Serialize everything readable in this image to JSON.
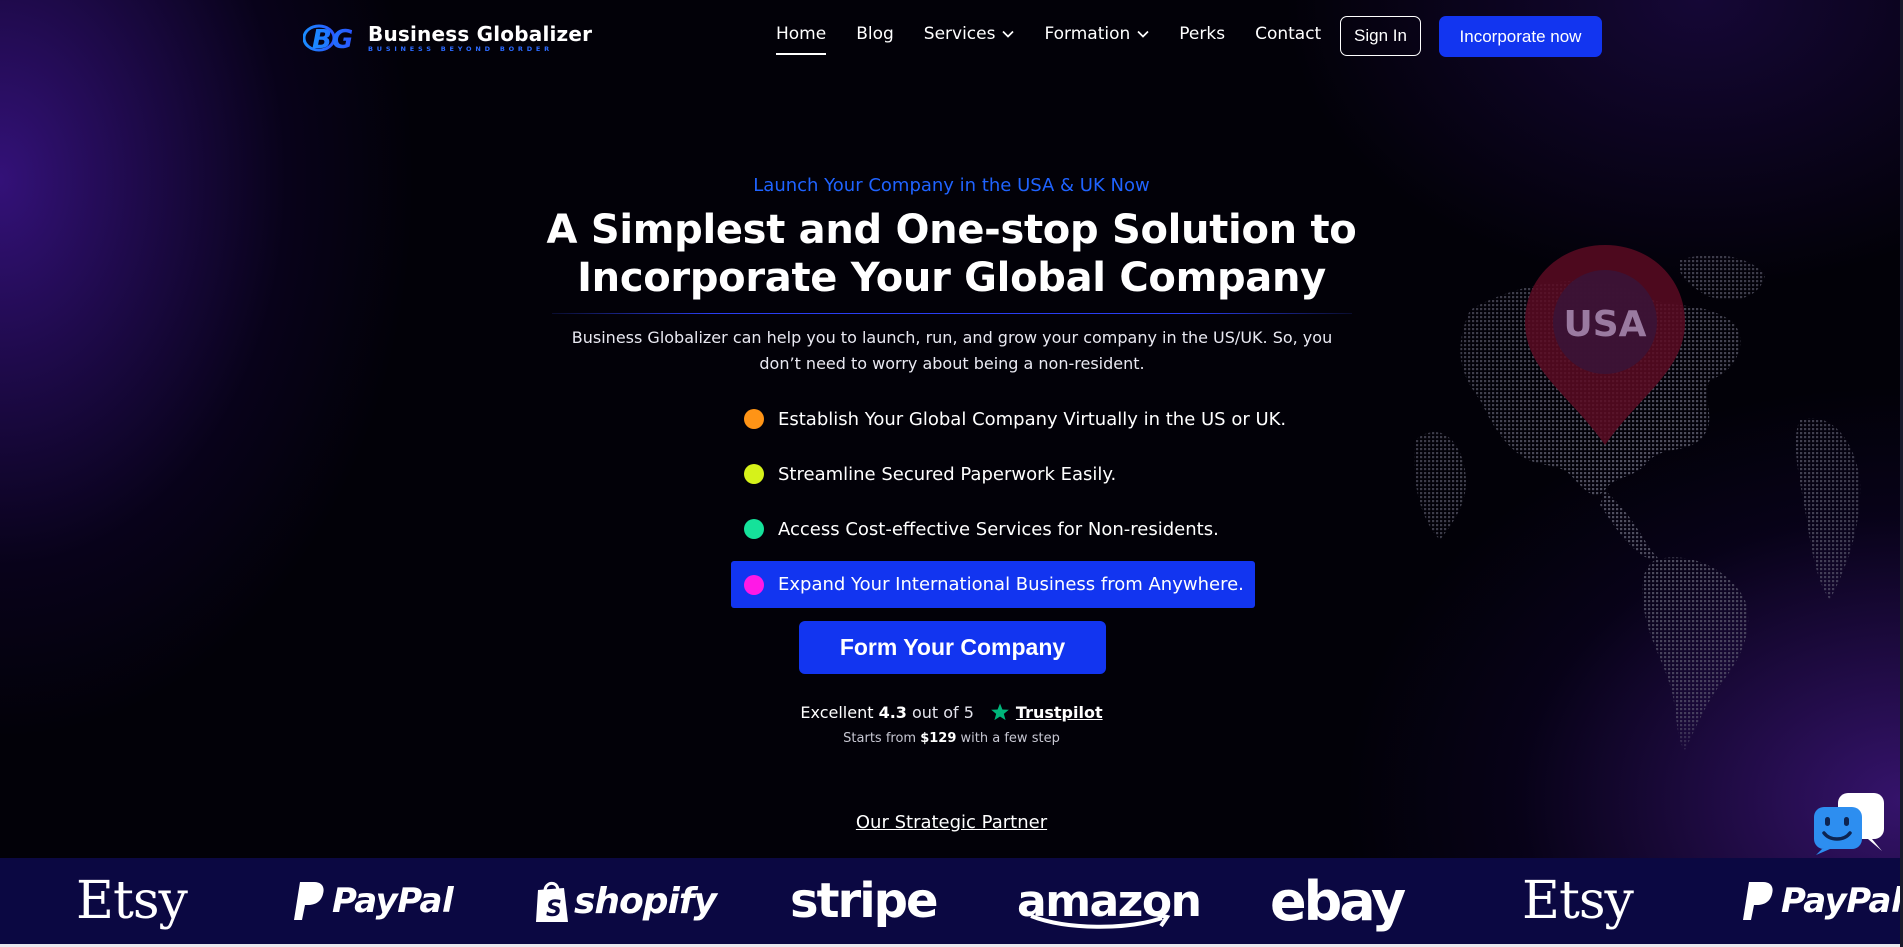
{
  "colors": {
    "accent": "#1235f0",
    "eyebrow": "#1f63ff",
    "dot_orange": "#ff9416",
    "dot_lime": "#d6f21a",
    "dot_green": "#15e29a",
    "dot_magenta": "#ff19e6",
    "trustpilot_green": "#00b67a",
    "strip_bg": "#0b0842"
  },
  "nav": {
    "logo": {
      "mark": "BG",
      "name": "Business Globalizer",
      "tagline": "BUSINESS BEYOND BORDER"
    },
    "links": [
      {
        "label": "Home",
        "active": true
      },
      {
        "label": "Blog"
      },
      {
        "label": "Services",
        "icon": "chevron-down-icon"
      },
      {
        "label": "Formation",
        "icon": "chevron-down-icon"
      },
      {
        "label": "Perks"
      },
      {
        "label": "Contact"
      }
    ],
    "sign_in": "Sign In",
    "incorporate": "Incorporate now"
  },
  "hero": {
    "eyebrow": "Launch Your Company in the USA & UK Now",
    "headline_line1": "A Simplest and One-stop Solution to",
    "headline_line2": "Incorporate Your Global Company",
    "description": "Business Globalizer can help you to launch, run, and grow your company in the US/UK. So, you don’t need to worry about being a non-resident.",
    "features": [
      {
        "text": "Establish Your Global Company Virtually in the US or UK.",
        "dot": "orange"
      },
      {
        "text": "Streamline Secured Paperwork Easily.",
        "dot": "lime"
      },
      {
        "text": "Access Cost-effective Services for Non-residents.",
        "dot": "green"
      },
      {
        "text": "Expand Your International Business from Anywhere.",
        "dot": "magenta",
        "highlighted": true
      }
    ],
    "cta": "Form Your Company",
    "rating": {
      "label": "Excellent",
      "score": "4.3",
      "suffix": "out of 5",
      "icon": "star-icon",
      "source": "Trustpilot"
    },
    "price_note": {
      "prefix": "Starts from",
      "price": "$129",
      "suffix": "with a few step"
    },
    "globe_pin": "USA"
  },
  "partners": {
    "title": "Our Strategic Partner",
    "logos": [
      "Etsy",
      "PayPal",
      "shopify",
      "stripe",
      "amazon",
      "ebay",
      "Etsy",
      "PayPal"
    ]
  },
  "chat_widget": {
    "icon": "chat-bot-icon"
  }
}
